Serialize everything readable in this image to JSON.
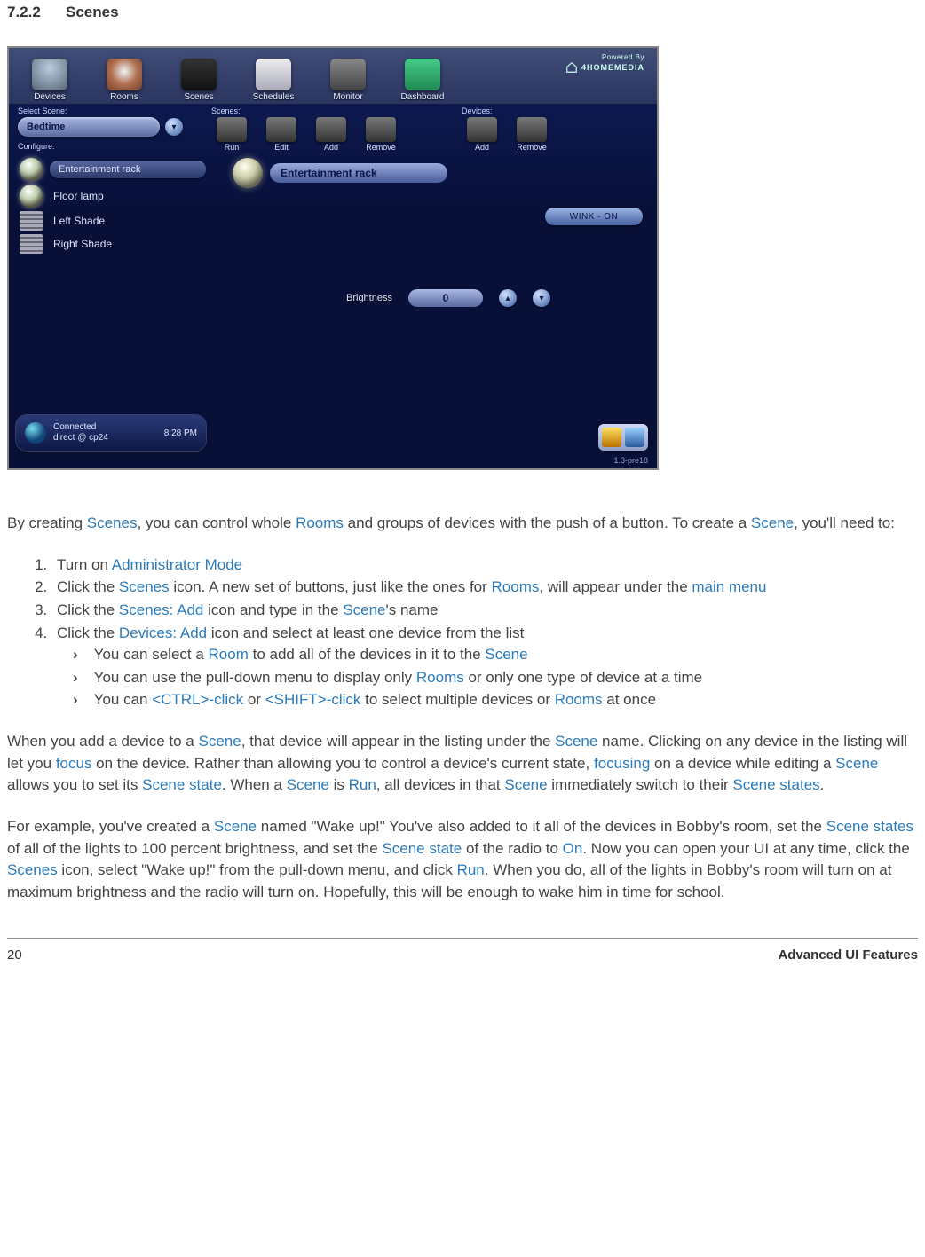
{
  "section": {
    "number": "7.2.2",
    "title": "Scenes"
  },
  "shot": {
    "brand_powered": "Powered By",
    "brand_name": "4HOMEMEDIA",
    "nav": [
      {
        "label": "Devices"
      },
      {
        "label": "Rooms"
      },
      {
        "label": "Scenes",
        "active": true
      },
      {
        "label": "Schedules"
      },
      {
        "label": "Monitor"
      },
      {
        "label": "Dashboard"
      }
    ],
    "select_scene_label": "Select Scene:",
    "selected_scene": "Bedtime",
    "configure_label": "Configure:",
    "scenes_group_label": "Scenes:",
    "scenes_buttons": [
      {
        "label": "Run"
      },
      {
        "label": "Edit"
      },
      {
        "label": "Add"
      },
      {
        "label": "Remove"
      }
    ],
    "devices_group_label": "Devices:",
    "devices_buttons": [
      {
        "label": "Add"
      },
      {
        "label": "Remove"
      }
    ],
    "device_list": [
      {
        "name": "Entertainment rack",
        "type": "bulb",
        "pill": true
      },
      {
        "name": "Floor lamp",
        "type": "bulb"
      },
      {
        "name": "Left Shade",
        "type": "shade"
      },
      {
        "name": "Right Shade",
        "type": "shade"
      }
    ],
    "focus_device": "Entertainment rack",
    "wink_label": "WINK - ON",
    "brightness_label": "Brightness",
    "brightness_value": "0",
    "status": {
      "line1": "Connected",
      "line2": "direct @ cp24",
      "time": "8:28 PM"
    },
    "version": "1.3-pre18"
  },
  "para1": {
    "t1": "By creating ",
    "h1": "Scenes",
    "t2": ", you can control whole ",
    "h2": "Rooms",
    "t3": " and groups of devices with the push of a button. To create a ",
    "h3": "Scene",
    "t4": ", you'll need to:"
  },
  "steps": {
    "s1": {
      "t1": "Turn on ",
      "h1": "Administrator Mode"
    },
    "s2": {
      "t1": "Click the ",
      "h1": "Scenes",
      "t2": " icon. A new set of buttons, just like the ones for ",
      "h2": "Rooms",
      "t3": ", will appear under the ",
      "h3": "main menu"
    },
    "s3": {
      "t1": "Click the ",
      "h1": "Scenes: Add",
      "t2": " icon and type in the ",
      "h2": "Scene",
      "t3": "'s name"
    },
    "s4": {
      "t1": "Click the ",
      "h1": "Devices: Add",
      "t2": " icon and select at least one device from the list"
    },
    "sub1": {
      "t1": "You can select a ",
      "h1": "Room",
      "t2": " to add all of the devices in it to the ",
      "h2": "Scene"
    },
    "sub2": {
      "t1": "You can use the pull-down menu to display only ",
      "h1": "Rooms",
      "t2": " or only one type of device at a time"
    },
    "sub3": {
      "t1": "You can ",
      "h1": "<CTRL>-click",
      "t2": " or ",
      "h2": "<SHIFT>-click",
      "t3": " to select multiple devices or ",
      "h3": "Rooms",
      "t4": " at once"
    }
  },
  "para2": {
    "t1": "When you add a device to a ",
    "h1": "Scene",
    "t2": ", that device will appear in the listing under the ",
    "h2": "Scene",
    "t3": " name. Clicking on any device in the listing will let you ",
    "h3": "focus",
    "t4": " on the device. Rather than allowing you to control a device's current state, ",
    "h4": "focusing",
    "t5": " on a device while editing a ",
    "h5": "Scene",
    "t6": " allows you to set its ",
    "h6": "Scene state",
    "t7": ". When a ",
    "h7": "Scene",
    "t8": " is ",
    "h8": "Run",
    "t9": ", all devices in that ",
    "h9": "Scene",
    "t10": " immediately switch to their ",
    "h10": "Scene states",
    "t11": "."
  },
  "para3": {
    "t1": "For example, you've created a ",
    "h1": "Scene",
    "t2": " named \"Wake up!\" You've also added to it all of the devices in Bobby's room, set the ",
    "h2": "Scene states",
    "t3": " of all of the lights to 100 percent brightness, and set the ",
    "h3": "Scene state",
    "t4": " of the radio to ",
    "h4": "On",
    "t5": ". Now you can open your UI at any time, click the ",
    "h5": "Scenes",
    "t6": " icon, select \"Wake up!\" from the pull-down menu, and click ",
    "h6": "Run",
    "t7": ". When you do, all of the lights in Bobby's room will turn on at maximum brightness and the radio will turn on. Hopefully, this will be enough to wake him in time for school."
  },
  "footer": {
    "page": "20",
    "title": "Advanced UI Features"
  }
}
